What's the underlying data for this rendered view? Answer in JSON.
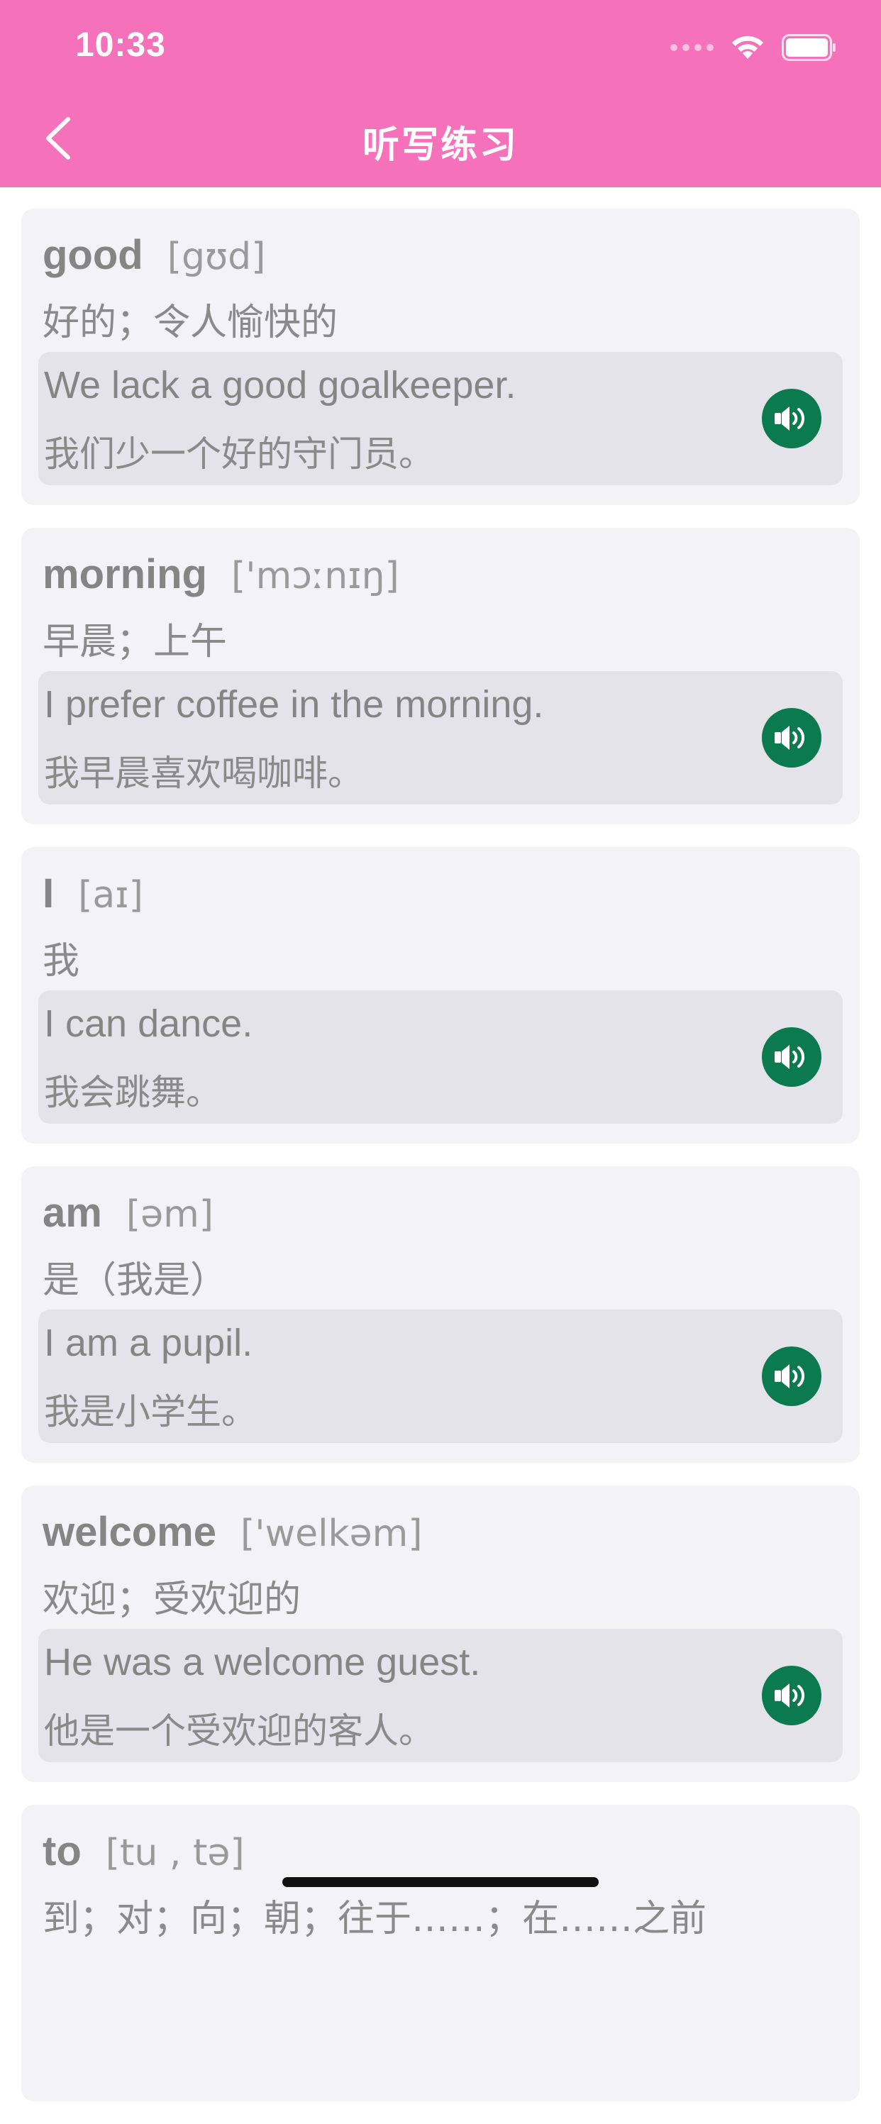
{
  "status_bar": {
    "time": "10:33"
  },
  "nav": {
    "title": "听写练习",
    "back_icon": "chevron-left-icon"
  },
  "colors": {
    "header_bg": "#F572BB",
    "card_bg": "#F2F2F7",
    "example_bg": "#E4E3EA",
    "speaker_bg": "#0B7A4F"
  },
  "words": [
    {
      "word": "good",
      "phonetic": "[gʊd]",
      "meaning": "好的；令人愉快的",
      "example_en": "We lack a good goalkeeper.",
      "example_zh": "我们少一个好的守门员。",
      "icon": "speaker-icon"
    },
    {
      "word": "morning",
      "phonetic": "['mɔːnɪŋ]",
      "meaning": "早晨；上午",
      "example_en": "I prefer coffee in the morning.",
      "example_zh": "我早晨喜欢喝咖啡。",
      "icon": "speaker-icon"
    },
    {
      "word": "I",
      "phonetic": "[aɪ]",
      "meaning": "我",
      "example_en": "I can dance.",
      "example_zh": "我会跳舞。",
      "icon": "speaker-icon"
    },
    {
      "word": "am",
      "phonetic": "[əm]",
      "meaning": "是（我是）",
      "example_en": "I am a pupil.",
      "example_zh": "我是小学生。",
      "icon": "speaker-icon"
    },
    {
      "word": "welcome",
      "phonetic": "['welkəm]",
      "meaning": "欢迎；受欢迎的",
      "example_en": "He was a welcome guest.",
      "example_zh": "他是一个受欢迎的客人。",
      "icon": "speaker-icon"
    },
    {
      "word": "to",
      "phonetic": "[tu , tə]",
      "meaning": "到；对；向；朝；往于……；在……之前",
      "example_en": "",
      "example_zh": "",
      "icon": "speaker-icon"
    }
  ]
}
